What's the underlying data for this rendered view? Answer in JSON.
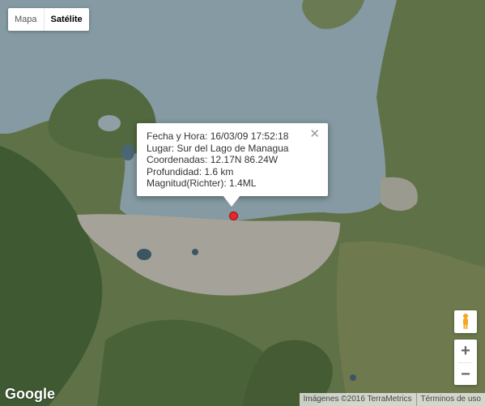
{
  "map_type": {
    "options": [
      "Mapa",
      "Satélite"
    ],
    "active": "Satélite"
  },
  "info_window": {
    "lines": [
      "Fecha y Hora: 16/03/09 17:52:18",
      "Lugar: Sur del Lago de Managua",
      "Coordenadas: 12.17N 86.24W",
      "Profundidad: 1.6 km",
      "Magnitud(Richter): 1.4ML"
    ],
    "close_symbol": "✕"
  },
  "controls": {
    "zoom_in": "+",
    "zoom_out": "−"
  },
  "logo": "Google",
  "attribution": {
    "imagery": "Imágenes ©2016 TerraMetrics",
    "terms": "Términos de uso"
  },
  "colors": {
    "lake": "#859aa2",
    "land": "#5c6e45",
    "urban": "#a5a399",
    "marker": "#e8262c"
  }
}
